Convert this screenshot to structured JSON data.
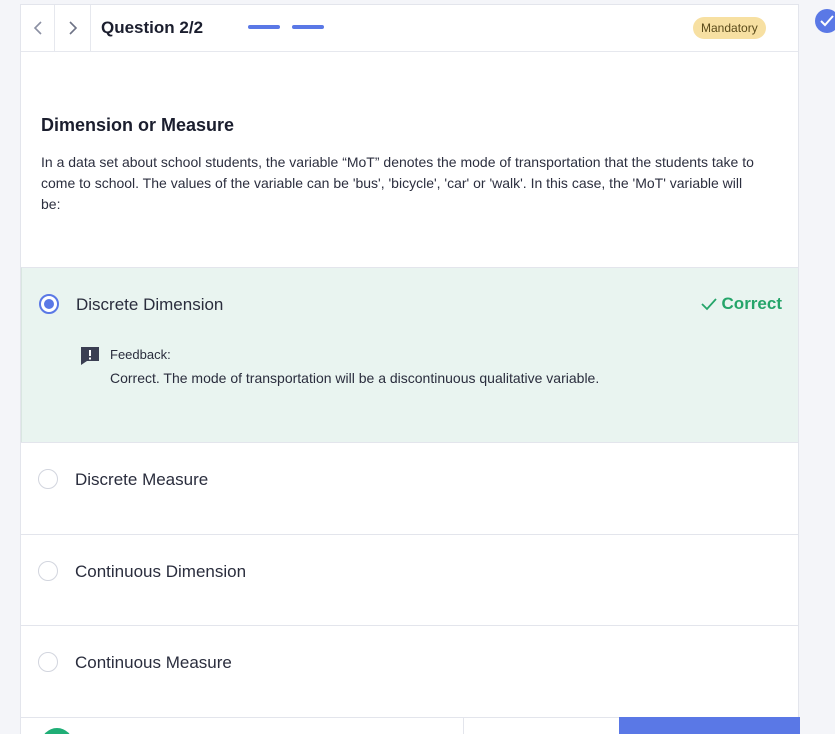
{
  "header": {
    "question_title": "Question 2/2",
    "progress_segments": 2,
    "badge": "Mandatory"
  },
  "question": {
    "heading": "Dimension or Measure",
    "text": "In a data set about school students, the variable “MoT” denotes the mode of transportation that the students take to come to school. The values of the variable can be 'bus', 'bicycle', 'car' or 'walk'. In this case, the 'MoT' variable will be:"
  },
  "options": [
    {
      "label": "Discrete Dimension",
      "selected": true
    },
    {
      "label": "Discrete Measure",
      "selected": false
    },
    {
      "label": "Continuous Dimension",
      "selected": false
    },
    {
      "label": "Continuous Measure",
      "selected": false
    }
  ],
  "result": {
    "status": "Correct",
    "feedback_label": "Feedback:",
    "feedback_text": "Correct. The mode of transportation will be a discontinuous qualitative variable."
  },
  "colors": {
    "accent": "#5a78e6",
    "correct": "#25a56a",
    "selected_bg": "#e9f4f0",
    "badge_bg": "#f7e0a2"
  },
  "icons": {
    "prev": "chevron-left-icon",
    "next": "chevron-right-icon",
    "correct": "checkmark-icon",
    "feedback": "exclamation-speech-bubble-icon"
  }
}
